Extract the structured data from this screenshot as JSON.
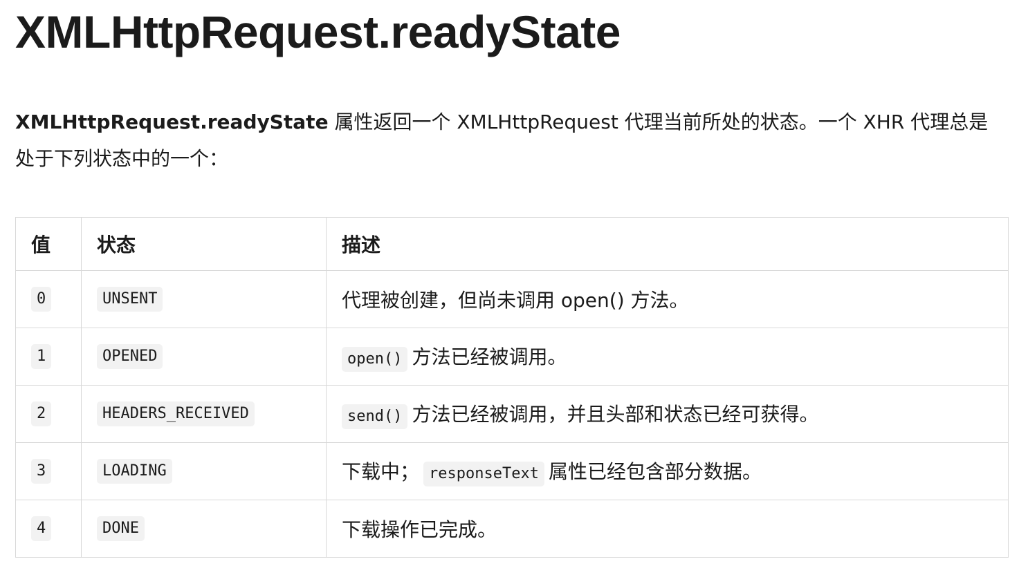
{
  "title": "XMLHttpRequest.readyState",
  "intro": {
    "strong": "XMLHttpRequest.readyState",
    "rest": " 属性返回一个 XMLHttpRequest 代理当前所处的状态。一个 XHR 代理总是处于下列状态中的一个："
  },
  "table": {
    "headers": [
      "值",
      "状态",
      "描述"
    ],
    "rows": [
      {
        "value": "0",
        "state": "UNSENT",
        "desc_pre": "代理被创建，但尚未调用 open() 方法。",
        "desc_code": "",
        "desc_post": ""
      },
      {
        "value": "1",
        "state": "OPENED",
        "desc_pre": "",
        "desc_code": "open()",
        "desc_post": "方法已经被调用。"
      },
      {
        "value": "2",
        "state": "HEADERS_RECEIVED",
        "desc_pre": "",
        "desc_code": "send()",
        "desc_post": "方法已经被调用，并且头部和状态已经可获得。"
      },
      {
        "value": "3",
        "state": "LOADING",
        "desc_pre": "下载中；",
        "desc_code": "responseText",
        "desc_post": "属性已经包含部分数据。"
      },
      {
        "value": "4",
        "state": "DONE",
        "desc_pre": "下载操作已完成。",
        "desc_code": "",
        "desc_post": ""
      }
    ]
  }
}
